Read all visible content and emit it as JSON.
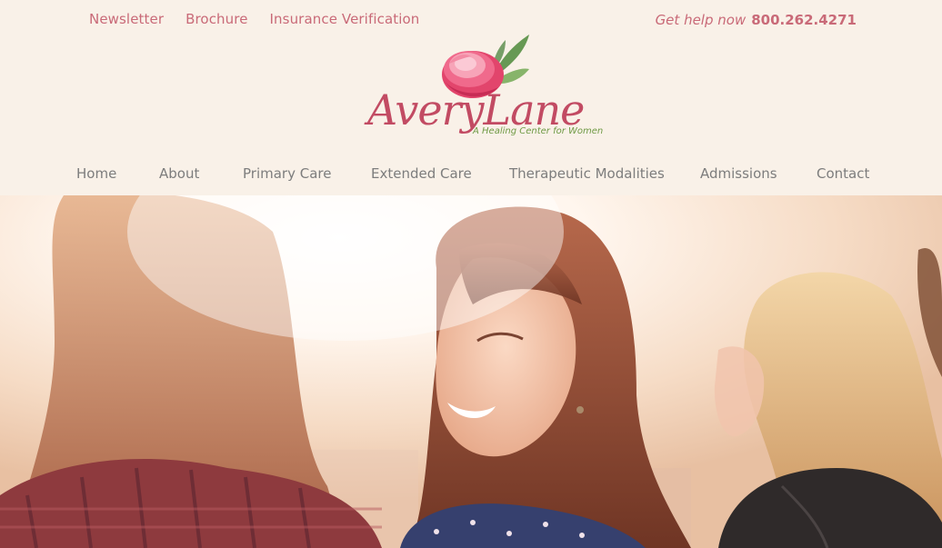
{
  "toplinks": [
    "Newsletter",
    "Brochure",
    "Insurance Verification"
  ],
  "help": {
    "label": "Get help now",
    "phone": "800.262.4271"
  },
  "logo": {
    "name": "AveryLane",
    "tagline": "A Healing Center for Women"
  },
  "nav": [
    "Home",
    "About",
    "Primary Care",
    "Extended Care",
    "Therapeutic Modalities",
    "Admissions",
    "Contact"
  ],
  "hero": {
    "image": "three-women-sunlight-photo"
  },
  "colors": {
    "background": "#f9f1e8",
    "accent": "#c96a78",
    "logo_pink": "#c24b63",
    "logo_green": "#6f9a45",
    "nav_text": "#7d7d7d"
  }
}
